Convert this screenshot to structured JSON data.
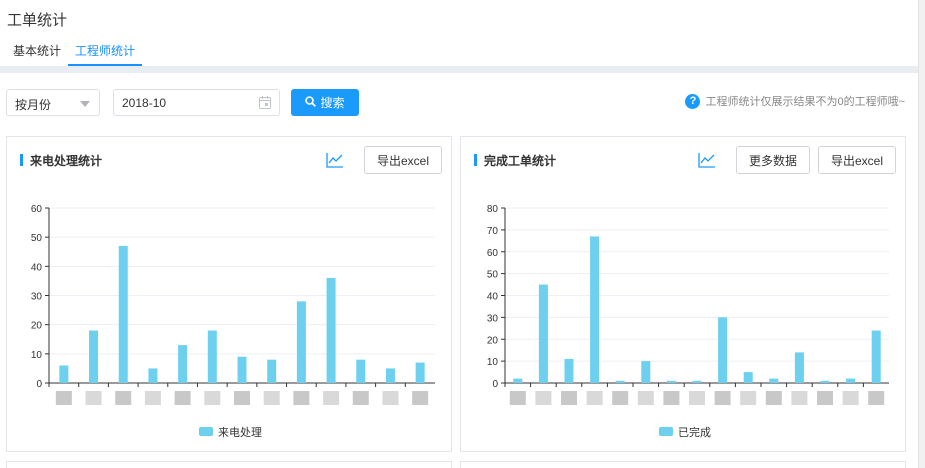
{
  "page_title": "工单统计",
  "tabs": [
    {
      "label": "基本统计",
      "active": false
    },
    {
      "label": "工程师统计",
      "active": true
    }
  ],
  "filters": {
    "period_select": "按月份",
    "date_value": "2018-10",
    "search_label": "搜索",
    "hint": "工程师统计仅展示结果不为0的工程师哦~"
  },
  "panels": {
    "left": {
      "title": "来电处理统计",
      "export_label": "导出excel"
    },
    "right": {
      "title": "完成工单统计",
      "more_label": "更多数据",
      "export_label": "导出excel"
    }
  },
  "colors": {
    "accent": "#1a9bfc",
    "bar": "#6dd0ee",
    "band": "#e8ecf3"
  },
  "chart_data": [
    {
      "type": "bar",
      "categories": [
        "",
        "",
        "",
        "",
        "",
        "",
        "",
        "",
        "",
        "",
        "",
        "",
        ""
      ],
      "series": [
        {
          "name": "来电处理",
          "values": [
            6,
            18,
            47,
            5,
            13,
            18,
            9,
            8,
            28,
            36,
            8,
            5,
            7
          ]
        }
      ],
      "ylim": [
        0,
        60
      ],
      "yticks": [
        "0",
        "10",
        "20",
        "30",
        "40",
        "50",
        "60"
      ],
      "grid": true,
      "legend": "bottom"
    },
    {
      "type": "bar",
      "categories": [
        "",
        "",
        "",
        "",
        "",
        "",
        "",
        "",
        "",
        "",
        "",
        "",
        "",
        "",
        "",
        ""
      ],
      "series": [
        {
          "name": "已完成",
          "values": [
            2,
            45,
            11,
            67,
            1,
            10,
            1,
            1,
            30,
            5,
            2,
            14,
            1,
            2,
            24
          ]
        }
      ],
      "ylim": [
        0,
        80
      ],
      "yticks": [
        "0",
        "10",
        "20",
        "30",
        "40",
        "50",
        "60",
        "70",
        "80"
      ],
      "grid": true,
      "legend": "bottom"
    }
  ]
}
